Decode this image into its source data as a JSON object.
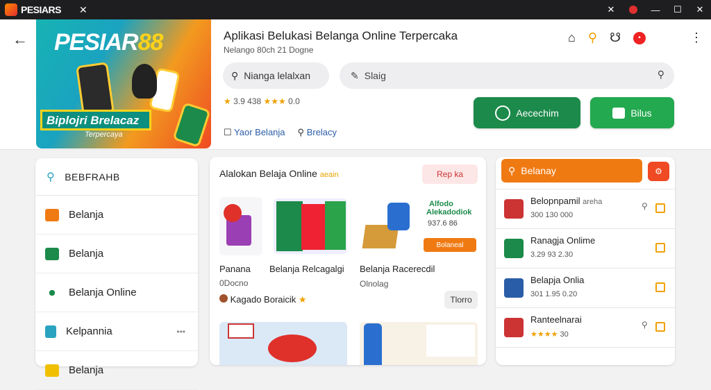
{
  "window": {
    "title": "PESIARS",
    "tab_close": "✕",
    "controls": [
      "✕",
      "—",
      "☐",
      "✕"
    ]
  },
  "banner": {
    "brand": "PESIAR",
    "brand_num": "88",
    "badge": "Biplojri Brelacaz",
    "subtitle": "Terpercaya"
  },
  "header": {
    "app_title": "Aplikasi Belukasi Belanga Online Terpercaka",
    "meta": "Nelango 80ch 21 Dogne",
    "chip_search": "Nianga lelalxan",
    "search_text": "Slaig",
    "rating_value": "3.9",
    "rating_count": "438",
    "rating_stars": "★★★",
    "rating_extra": "0.0",
    "pill_1": "Yaor Belanja",
    "pill_2": "Brelacy",
    "btn_primary": "Aecechim",
    "btn_secondary": "Bilus",
    "notif_count": "•"
  },
  "sidebar": {
    "search_label": "BEBFRAHB",
    "items": [
      {
        "label": "Belanja",
        "color": "#f07a12"
      },
      {
        "label": "Belanja",
        "color": "#1b8a4a"
      },
      {
        "label": "Belanja Online",
        "color": "#1b8a4a"
      },
      {
        "label": "Kelpannia",
        "color": "#2aa3c0"
      },
      {
        "label": "Belanja",
        "color": "#f0c000"
      }
    ]
  },
  "center": {
    "title": "Alalokan Belaja Online",
    "title_tag": "aeain",
    "tag_btn": "Rep ka",
    "promo_btn": "Bolaneal",
    "promo_text_1": "Alfodo",
    "promo_text_2": "Alekadodiok",
    "promo_price": "937.6 86",
    "products": [
      {
        "label": "Panana",
        "sub": "0Docno"
      },
      {
        "label": "Belanja Relcagalgi",
        "sub": ""
      },
      {
        "label": "Belanja Racerecdil",
        "sub": "Olnolag"
      }
    ],
    "store": "Kagado Boraicik",
    "store_btn": "Tlorro"
  },
  "right": {
    "search": "Belanay",
    "items": [
      {
        "name": "Belopnpamil",
        "tag": "areha",
        "meta": "300 130 000",
        "stars": "",
        "color": "#c33"
      },
      {
        "name": "Ranagja Onlime",
        "tag": "",
        "meta": "3.29 93 2.30",
        "stars": "",
        "color": "#1b8a4a"
      },
      {
        "name": "Belapja Onlia",
        "tag": "",
        "meta": "301 1.95 0.20",
        "stars": "",
        "color": "#2a5da8"
      },
      {
        "name": "Ranteelnarai",
        "tag": "",
        "meta": "30",
        "stars": "★★★★",
        "color": "#c33"
      }
    ]
  }
}
